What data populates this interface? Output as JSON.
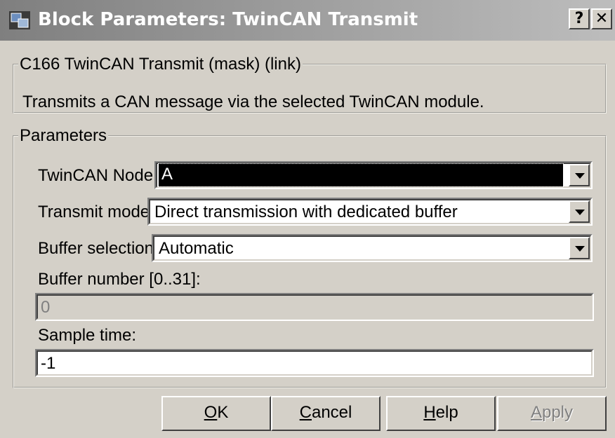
{
  "window": {
    "title": "Block Parameters: TwinCAN Transmit",
    "icon": "simulink-block-icon",
    "title_help": "?",
    "title_close": "✕"
  },
  "description": {
    "legend": "C166 TwinCAN Transmit (mask) (link)",
    "text": "Transmits a CAN message via the selected TwinCAN module."
  },
  "parameters": {
    "legend": "Parameters",
    "twincan_node": {
      "label": "TwinCAN Node:",
      "value": "A"
    },
    "transmit_mode": {
      "label": "Transmit mode:",
      "value": "Direct transmission with dedicated buffer"
    },
    "buffer_selection": {
      "label": "Buffer selection:",
      "value": "Automatic"
    },
    "buffer_number": {
      "label": "Buffer number [0..31]:",
      "value": "0"
    },
    "sample_time": {
      "label": "Sample time:",
      "value": "-1"
    }
  },
  "buttons": {
    "ok": {
      "mnemonic": "O",
      "rest": "K"
    },
    "cancel": {
      "mnemonic": "C",
      "rest": "ancel"
    },
    "help": {
      "mnemonic": "H",
      "rest": "elp"
    },
    "apply": {
      "mnemonic": "A",
      "rest": "pply"
    }
  }
}
